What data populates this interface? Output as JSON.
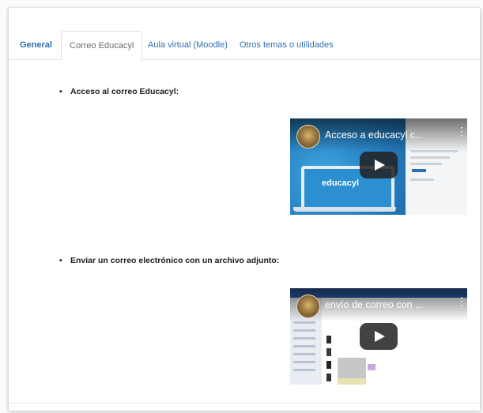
{
  "tabs": [
    {
      "label": "General",
      "active": false
    },
    {
      "label": "Correo Educacyl",
      "active": true
    },
    {
      "label": "Aula virtual (Moodle)",
      "active": false
    },
    {
      "label": "Otros temas o utilidades",
      "active": false
    }
  ],
  "sections": [
    {
      "bullet": "•",
      "text": "Acceso al correo Educacyl:"
    },
    {
      "bullet": "•",
      "text": "Enviar un correo electrónico con un archivo adjunto:"
    }
  ],
  "videos": [
    {
      "title": "Acceso a educacyl c...",
      "overlay_text": "educacyl"
    },
    {
      "title": "envío de correo con ..."
    }
  ],
  "colors": {
    "link": "#2f6fb0",
    "active_tab_text": "#6b6b6b"
  },
  "icons": {
    "play": "play-icon",
    "menu": "more-vert-icon",
    "avatar": "channel-avatar"
  }
}
